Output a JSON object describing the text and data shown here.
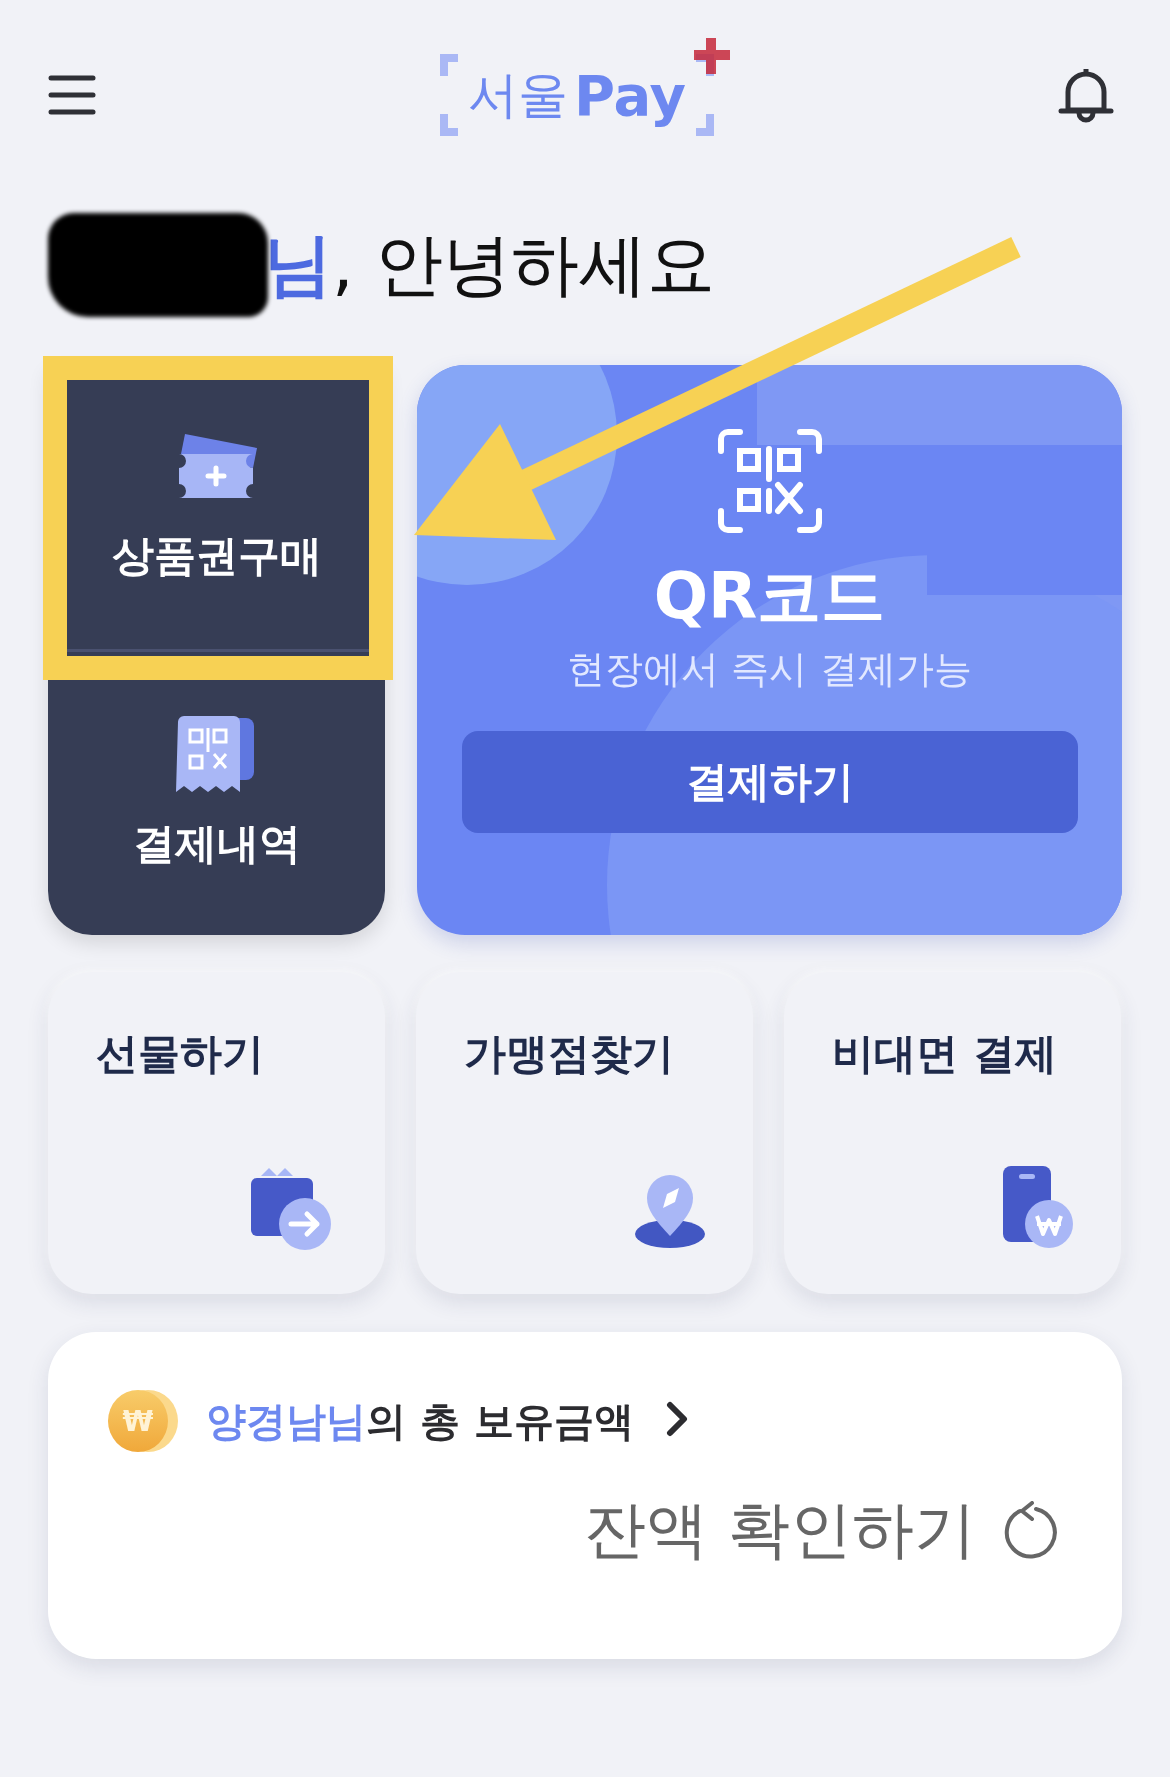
{
  "header": {
    "logo": {
      "text_ko": "서울",
      "text_en": "Pay"
    }
  },
  "greeting": {
    "redacted": true,
    "name_suffix": "님",
    "text": ", 안녕하세요"
  },
  "menu": {
    "left": [
      {
        "label": "상품권구매",
        "kind": "voucher"
      },
      {
        "label": "결제내역",
        "kind": "history"
      }
    ],
    "qr": {
      "title": "QR코드",
      "subtitle": "현장에서 즉시 결제가능",
      "button": "결제하기"
    }
  },
  "quick": [
    {
      "label": "선물하기",
      "kind": "gift"
    },
    {
      "label": "가맹점찾기",
      "kind": "store"
    },
    {
      "label": "비대면 결제",
      "kind": "contactless"
    }
  ],
  "balance": {
    "coin_symbol": "₩",
    "owner": "양경남님",
    "title": "의 총 보유금액",
    "action": "잔액 확인하기"
  }
}
